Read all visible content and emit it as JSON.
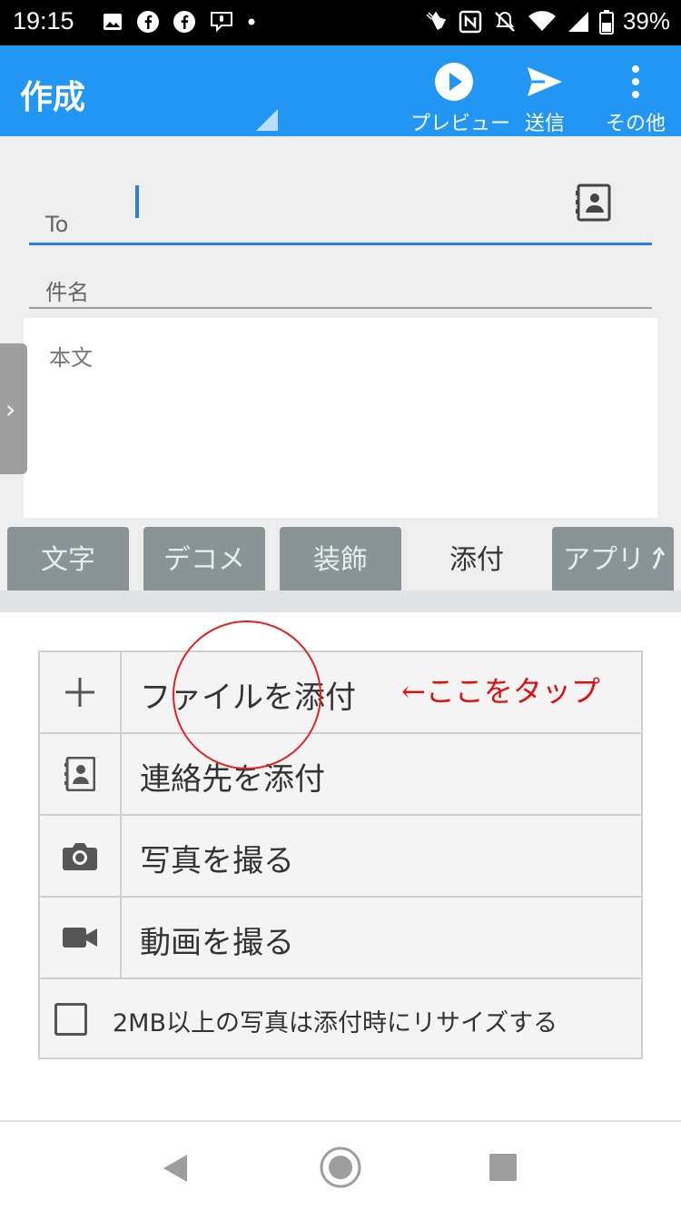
{
  "status_bar": {
    "time": "19:15",
    "battery": "39%",
    "left_icons": [
      "image-icon",
      "facebook-icon",
      "facebook-icon",
      "voice-message-icon",
      "dot-icon"
    ],
    "right_icons": [
      "touch-icon",
      "nfc-icon",
      "mute-bell-icon",
      "wifi-icon",
      "signal-icon",
      "battery-icon"
    ]
  },
  "app_bar": {
    "title": "作成",
    "actions": {
      "preview": "プレビュー",
      "send": "送信",
      "more": "その他"
    },
    "color": "#2196f3"
  },
  "compose": {
    "to_label": "To",
    "to_value": "",
    "subject_label": "件名",
    "body_label": "本文"
  },
  "tabs": [
    {
      "label": "文字",
      "active": false
    },
    {
      "label": "デコメ",
      "active": false
    },
    {
      "label": "装飾",
      "active": false
    },
    {
      "label": "添付",
      "active": true
    },
    {
      "label": "アプリ",
      "active": false
    }
  ],
  "attach": {
    "items": [
      {
        "icon": "plus-icon",
        "label": "ファイルを添付"
      },
      {
        "icon": "contact-card-icon",
        "label": "連絡先を添付"
      },
      {
        "icon": "camera-icon",
        "label": "写真を撮る"
      },
      {
        "icon": "video-camera-icon",
        "label": "動画を撮る"
      }
    ],
    "resize_label": "2MB以上の写真は添付時にリサイズする",
    "resize_checked": false
  },
  "annotation": {
    "text": "←ここをタップ",
    "color": "#e01010"
  },
  "nav_bar": {
    "buttons": [
      "back-icon",
      "home-icon",
      "recents-icon"
    ]
  }
}
